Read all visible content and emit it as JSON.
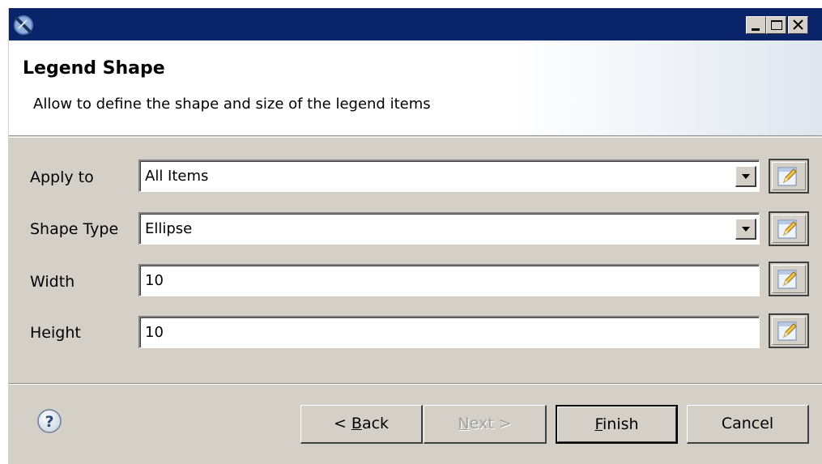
{
  "window": {
    "app_icon": "eclipse-app-icon",
    "controls": [
      "minimize-icon",
      "maximize-icon",
      "close-icon"
    ]
  },
  "banner": {
    "title": "Legend Shape",
    "description": "Allow to define the shape and size of the legend items"
  },
  "form": {
    "apply_to": {
      "label": "Apply to",
      "value": "All Items",
      "control": "dropdown"
    },
    "shape_type": {
      "label": "Shape Type",
      "value": "Ellipse",
      "control": "dropdown"
    },
    "width": {
      "label": "Width",
      "value": "10",
      "control": "text"
    },
    "height": {
      "label": "Height",
      "value": "10",
      "control": "text"
    },
    "edit_icon": "pencil-edit-icon"
  },
  "footer": {
    "help_icon": "help-icon",
    "back_prefix": "< ",
    "back_mnemonic": "B",
    "back_rest": "ack",
    "next_mnemonic": "N",
    "next_rest": "ext >",
    "finish_mnemonic": "F",
    "finish_rest": "inish",
    "cancel_label": "Cancel"
  }
}
